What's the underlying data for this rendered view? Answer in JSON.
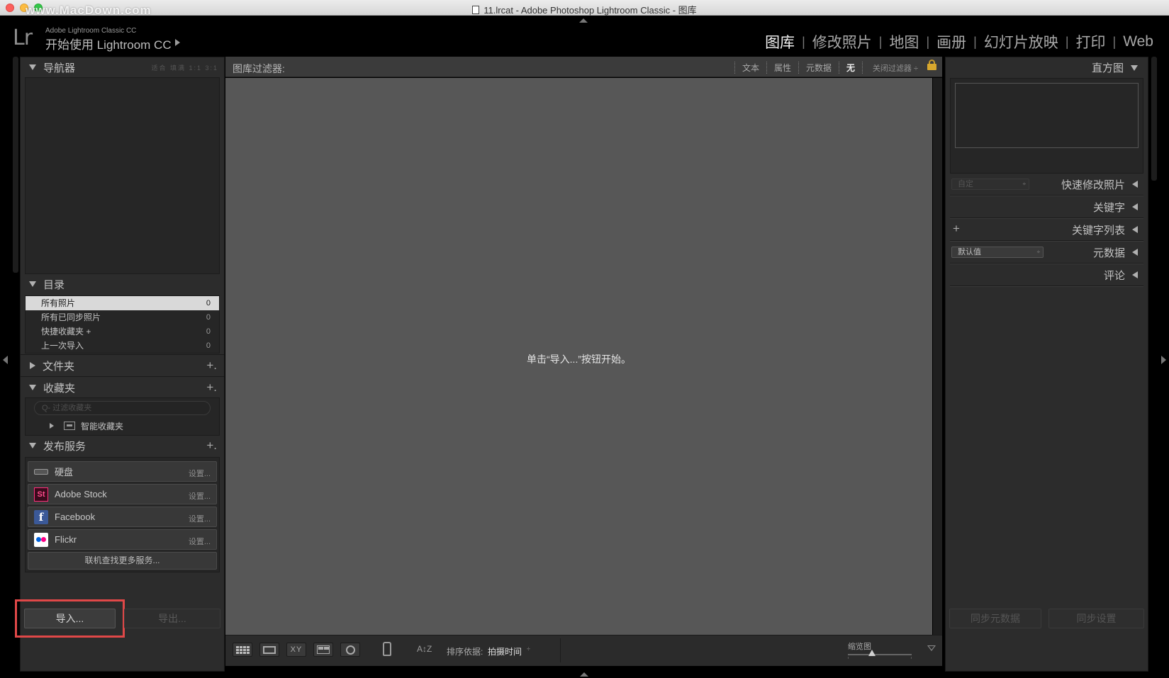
{
  "window": {
    "title": "11.lrcat - Adobe Photoshop Lightroom Classic - 图库",
    "watermark": "www.MacDown.com"
  },
  "header": {
    "logo": "Lr",
    "brand_small": "Adobe Lightroom Classic CC",
    "brand_big": "开始使用 Lightroom CC",
    "modules": [
      "图库",
      "修改照片",
      "地图",
      "画册",
      "幻灯片放映",
      "打印",
      "Web"
    ],
    "active_module": "图库"
  },
  "left_panel": {
    "navigator": {
      "title": "导航器",
      "zoom_options": "适合 填满 1:1 3:1"
    },
    "catalog": {
      "title": "目录",
      "items": [
        {
          "label": "所有照片",
          "count": "0",
          "selected": true
        },
        {
          "label": "所有已同步照片",
          "count": "0"
        },
        {
          "label": "快捷收藏夹 +",
          "count": "0"
        },
        {
          "label": "上一次导入",
          "count": "0"
        }
      ]
    },
    "folders": {
      "title": "文件夹",
      "add": "+."
    },
    "collections": {
      "title": "收藏夹",
      "add": "+.",
      "search_placeholder": "Q- 过滤收藏夹",
      "items": [
        "智能收藏夹"
      ]
    },
    "publish": {
      "title": "发布服务",
      "add": "+.",
      "services": [
        {
          "name": "硬盘",
          "setup": "设置..."
        },
        {
          "name": "Adobe Stock",
          "setup": "设置...",
          "icon_text": "St"
        },
        {
          "name": "Facebook",
          "setup": "设置...",
          "icon_text": "f"
        },
        {
          "name": "Flickr",
          "setup": "设置..."
        }
      ],
      "find_more": "联机查找更多服务..."
    },
    "import_label": "导入...",
    "export_label": "导出..."
  },
  "filter_bar": {
    "title": "图库过滤器:",
    "tabs": [
      "文本",
      "属性",
      "元数据",
      "无"
    ],
    "close_filters": "关闭过滤器 ÷"
  },
  "center": {
    "message": "单击“导入...”按钮开始。"
  },
  "toolbar": {
    "view_xy": "XY",
    "sort_icon": "A↕Z",
    "sort_label": "排序依据:",
    "sort_value": "拍摄时间",
    "sort_updown": "÷",
    "thumb_label": "缩览图"
  },
  "right_panel": {
    "histogram": "直方图",
    "quick_develop": "快速修改照片",
    "quick_develop_preset": "自定",
    "keywording": "关键字",
    "keyword_list": "关键字列表",
    "keyword_add": "+",
    "metadata": "元数据",
    "metadata_preset": "默认值",
    "comments": "评论",
    "sync_metadata": "同步元数据",
    "sync_settings": "同步设置"
  },
  "colors": {
    "highlight_border": "#e04848",
    "center_bg": "#575757",
    "panel_bg": "#2c2c2c"
  }
}
